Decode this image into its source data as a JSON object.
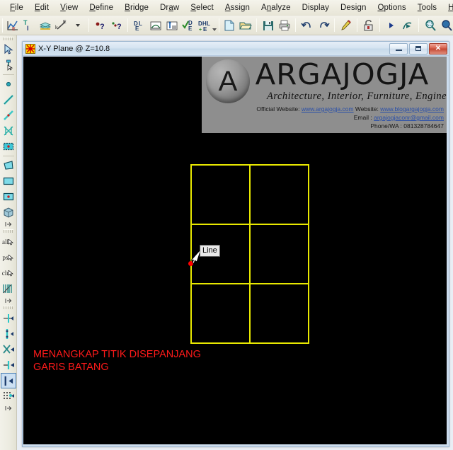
{
  "menu": {
    "items": [
      {
        "label": "File",
        "accel": "F"
      },
      {
        "label": "Edit",
        "accel": "E"
      },
      {
        "label": "View",
        "accel": "V"
      },
      {
        "label": "Define",
        "accel": "D"
      },
      {
        "label": "Bridge",
        "accel": "B"
      },
      {
        "label": "Draw",
        "accel": "a"
      },
      {
        "label": "Select",
        "accel": "S"
      },
      {
        "label": "Assign",
        "accel": "A"
      },
      {
        "label": "Analyze",
        "accel": "n"
      },
      {
        "label": "Display",
        "accel": "D"
      },
      {
        "label": "Design",
        "accel": "g"
      },
      {
        "label": "Options",
        "accel": "O"
      },
      {
        "label": "Tools",
        "accel": "T"
      },
      {
        "label": "Help",
        "accel": "H"
      }
    ]
  },
  "toolbar": {
    "buttons": [
      {
        "name": "run-analysis-icon",
        "title": "Run Analysis"
      },
      {
        "name": "set-display-options-icon",
        "title": "Set Display Options"
      },
      {
        "name": "layers-icon",
        "title": "Object Layers"
      },
      {
        "name": "section-cut-icon",
        "title": "Section Cut"
      },
      {
        "name": "dropdown-arrow-icon",
        "title": "More"
      },
      {
        "name": "query-point-icon",
        "title": "Query Point"
      },
      {
        "name": "query-info-icon",
        "title": "Query Information"
      },
      {
        "name": "define-load-icon",
        "title": "Define Load"
      },
      {
        "name": "bridge-object-icon",
        "title": "Bridge Object"
      },
      {
        "name": "bridge-section-icon",
        "title": "Bridge Section"
      },
      {
        "name": "check-design-icon",
        "title": "Check Design"
      },
      {
        "name": "design-load-icon",
        "title": "Design Load"
      },
      {
        "name": "new-model-icon",
        "title": "New Model"
      },
      {
        "name": "open-file-icon",
        "title": "Open File"
      },
      {
        "name": "save-icon",
        "title": "Save"
      },
      {
        "name": "print-icon",
        "title": "Print"
      },
      {
        "name": "undo-icon",
        "title": "Undo"
      },
      {
        "name": "redo-icon",
        "title": "Redo"
      },
      {
        "name": "edit-pencil-icon",
        "title": "Edit"
      },
      {
        "name": "lock-unlock-icon",
        "title": "Lock / Unlock Model"
      },
      {
        "name": "run-arrow-icon",
        "title": "Run"
      },
      {
        "name": "run-analysis-now-icon",
        "title": "Run Analysis Now"
      },
      {
        "name": "zoom-window-icon",
        "title": "Rubber Band Zoom"
      },
      {
        "name": "zoom-full-icon",
        "title": "Restore Full View"
      },
      {
        "name": "zoom-previous-icon",
        "title": "Previous Zoom"
      },
      {
        "name": "zoom-in-icon",
        "title": "Zoom In One Step"
      },
      {
        "name": "zoom-out-icon",
        "title": "Zoom Out One Step"
      },
      {
        "name": "pan-icon",
        "title": "Pan"
      }
    ]
  },
  "left_toolbar": {
    "buttons": [
      {
        "name": "pointer-select-icon",
        "title": "Set Select Mode",
        "selected": false
      },
      {
        "name": "reshape-element-icon",
        "title": "Set Reshape Element Mode",
        "selected": false
      },
      {
        "name": "draw-point-icon",
        "title": "Draw Special Joint",
        "selected": false
      },
      {
        "name": "draw-frame-icon",
        "title": "Draw Frame / Cable Element",
        "selected": false
      },
      {
        "name": "quick-draw-frame-icon",
        "title": "Quick Draw Frame / Cable Element",
        "selected": false
      },
      {
        "name": "quick-draw-braces-icon",
        "title": "Quick Draw Braces",
        "selected": false
      },
      {
        "name": "quick-draw-secondary-icon",
        "title": "Quick Draw Secondary Beams",
        "selected": false
      },
      {
        "name": "draw-poly-area-icon",
        "title": "Draw Poly Area",
        "selected": false
      },
      {
        "name": "draw-rect-area-icon",
        "title": "Draw Rectangular Area",
        "selected": false
      },
      {
        "name": "quick-draw-area-icon",
        "title": "Quick Draw Area",
        "selected": false
      },
      {
        "name": "draw-solid-icon",
        "title": "Draw Solid",
        "selected": false
      },
      {
        "name": "select-all-icon",
        "title": "Select All",
        "label": "all",
        "selected": false
      },
      {
        "name": "get-previous-selection-icon",
        "title": "Get Previous Selection",
        "label": "ps",
        "selected": false
      },
      {
        "name": "clear-selection-icon",
        "title": "Clear Selection",
        "label": "clr",
        "selected": false
      },
      {
        "name": "restore-view-icon",
        "title": "Restore Previous Selection",
        "selected": false
      },
      {
        "name": "snap-to-point-icon",
        "title": "Snap to Joints and Grid Points",
        "selected": false
      },
      {
        "name": "snap-to-midpoint-icon",
        "title": "Snap to Middle and Ends",
        "selected": false
      },
      {
        "name": "snap-to-intersection-icon",
        "title": "Snap to Intersections",
        "selected": false
      },
      {
        "name": "snap-perpendicular-icon",
        "title": "Snap to Perpendicular Projections",
        "selected": false
      },
      {
        "name": "snap-to-line-icon",
        "title": "Snap to Lines and Edges",
        "selected": true
      },
      {
        "name": "snap-to-fine-grid-icon",
        "title": "Snap to Fine Grid",
        "selected": false
      }
    ]
  },
  "child_window": {
    "title": "X-Y Plane @ Z=10.8",
    "minimize_label": "Minimize",
    "maximize_label": "Maximize",
    "close_label": "✕"
  },
  "watermark": {
    "badge_letter": "A",
    "title": "ARGAJOGJA",
    "tagline": "Architecture, Interior, Furniture, Engineering",
    "line1_prefix": "Official Website:",
    "line1_link1": "www.argajogja.com",
    "line1_mid": "Website:",
    "line1_link2": "www.blogargajogja.com",
    "line2_prefix": "Email :",
    "line2_link": "argajogjaconr@gmail.com",
    "line3": "Phone/WA : 081328784647"
  },
  "canvas": {
    "tooltip_text": "Line",
    "note_text": "MENANGKAP TITIK DISEPANJANG\nGARIS BATANG",
    "grid_color": "#e8e800",
    "snap_point_color": "#ff0000",
    "background_color": "#000000",
    "grid_columns": 2,
    "grid_rows": 3
  }
}
